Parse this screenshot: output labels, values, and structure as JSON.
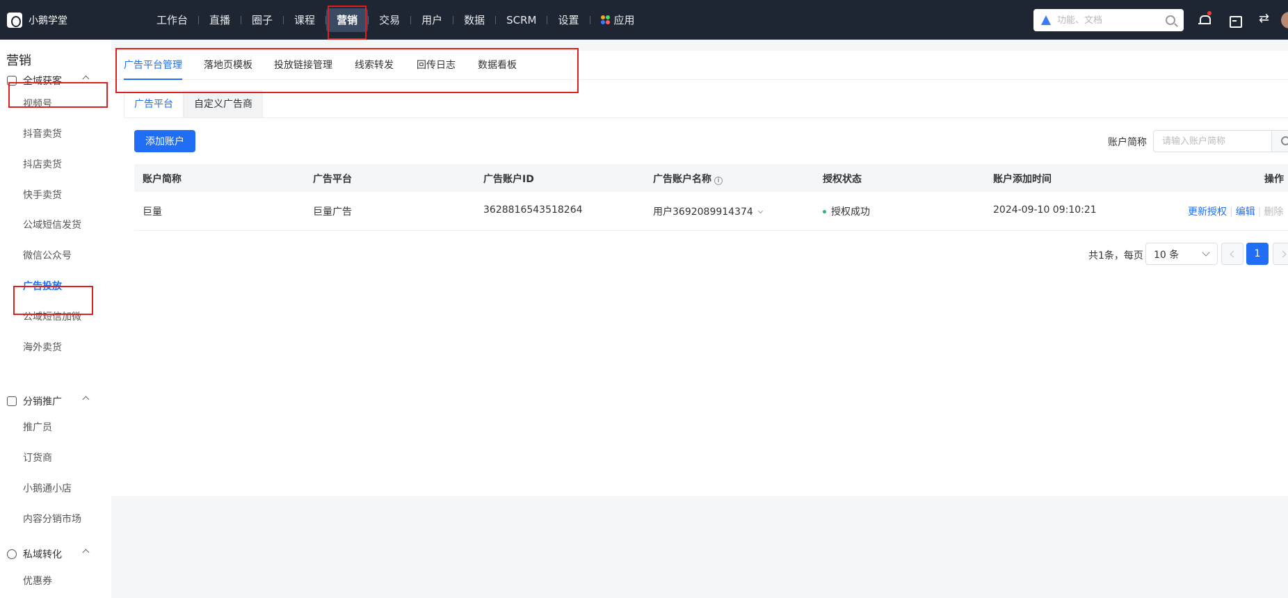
{
  "app": {
    "name": "小鹅学堂"
  },
  "topnav": {
    "items": [
      {
        "label": "工作台"
      },
      {
        "label": "直播"
      },
      {
        "label": "圈子"
      },
      {
        "label": "课程"
      },
      {
        "label": "营销"
      },
      {
        "label": "交易"
      },
      {
        "label": "用户"
      },
      {
        "label": "数据"
      },
      {
        "label": "SCRM"
      },
      {
        "label": "设置"
      },
      {
        "label": "应用"
      }
    ],
    "active": "营销",
    "search_placeholder": "功能、文档"
  },
  "sidebar": {
    "title": "营销",
    "groups": [
      {
        "label": "全域获客",
        "items": [
          "视频号",
          "抖音卖货",
          "抖店卖货",
          "快手卖货",
          "公域短信发货",
          "微信公众号",
          "广告投放",
          "公域短信加微",
          "海外卖货"
        ]
      },
      {
        "label": "分销推广",
        "items": [
          "推广员",
          "订货商",
          "小鹅通小店",
          "内容分销市场"
        ]
      },
      {
        "label": "私域转化",
        "items": [
          "优惠券"
        ]
      }
    ],
    "active_item": "广告投放"
  },
  "tabs": [
    "广告平台管理",
    "落地页模板",
    "投放链接管理",
    "线索转发",
    "回传日志",
    "数据看板"
  ],
  "subtabs": [
    "广告平台",
    "自定义广告商"
  ],
  "toolbar": {
    "add_button": "添加账户",
    "filter_label": "账户简称",
    "filter_placeholder": "请输入账户简称"
  },
  "table": {
    "columns": [
      "账户简称",
      "广告平台",
      "广告账户ID",
      "广告账户名称",
      "授权状态",
      "账户添加时间",
      "操作"
    ],
    "rows": [
      {
        "short_name": "巨量",
        "platform": "巨量广告",
        "account_id": "3628816543518264",
        "account_name": "用户3692089914374",
        "status": "授权成功",
        "added_time": "2024-09-10 09:10:21",
        "actions": [
          "更新授权",
          "编辑",
          "删除"
        ]
      }
    ]
  },
  "pagination": {
    "total_text": "共1条，每页",
    "page_size": "10 条",
    "current_page": "1"
  },
  "colors": {
    "topbar": "#1f2633",
    "primary": "#1f6ef5",
    "annotation": "#e01e1e",
    "status_success": "#2bb673"
  }
}
